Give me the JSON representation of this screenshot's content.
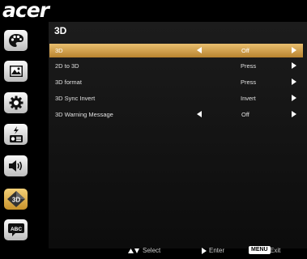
{
  "brand": "acer",
  "menu_title": "3D",
  "sidebar": {
    "items": [
      {
        "icon": "palette-icon",
        "active": false
      },
      {
        "icon": "image-icon",
        "active": false
      },
      {
        "icon": "settings-gear-icon",
        "active": false
      },
      {
        "icon": "power-management-icon",
        "active": false
      },
      {
        "icon": "audio-speaker-icon",
        "active": false
      },
      {
        "icon": "3d-icon",
        "active": true,
        "label": "3D"
      },
      {
        "icon": "language-icon",
        "active": false,
        "label": "ABC"
      }
    ]
  },
  "rows": [
    {
      "label": "3D",
      "value": "Off",
      "left_arrow": true,
      "right_arrow": true,
      "selected": true
    },
    {
      "label": "2D to 3D",
      "value": "Press",
      "left_arrow": false,
      "right_arrow": true,
      "selected": false
    },
    {
      "label": "3D format",
      "value": "Press",
      "left_arrow": false,
      "right_arrow": true,
      "selected": false
    },
    {
      "label": "3D Sync Invert",
      "value": "Invert",
      "left_arrow": false,
      "right_arrow": true,
      "selected": false
    },
    {
      "label": "3D Warning Message",
      "value": "Off",
      "left_arrow": true,
      "right_arrow": true,
      "selected": false
    }
  ],
  "footer": {
    "select_label": "Select",
    "enter_label": "Enter",
    "menu_key": "MENU",
    "exit_label": "Exit"
  },
  "colors": {
    "selected_row": "#d9a650",
    "active_sidebar": "#e0ab48"
  }
}
